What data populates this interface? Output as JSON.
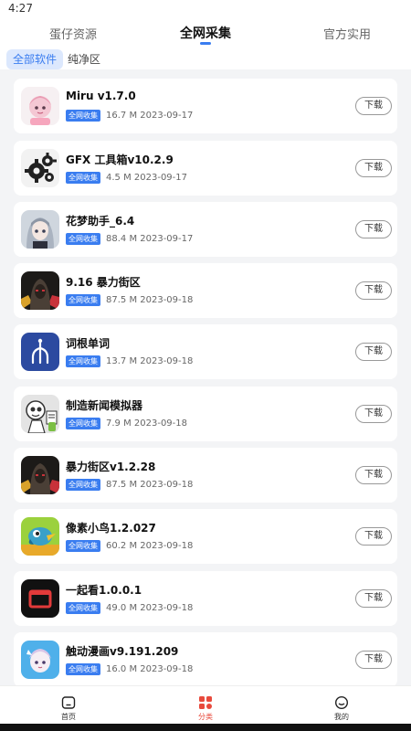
{
  "status_bar": {
    "time": "4:27"
  },
  "top_tabs": [
    "蛋仔资源",
    "全网采集",
    "官方实用"
  ],
  "sub_tabs": [
    "全部软件",
    "纯净区"
  ],
  "download_label": "下载",
  "badge_label": "全网收集",
  "apps": [
    {
      "name": "Miru v1.7.0",
      "meta": "16.7 M 2023-09-17",
      "icon": "miru-anime-girl-icon"
    },
    {
      "name": "GFX 工具箱v10.2.9",
      "meta": "4.5 M 2023-09-17",
      "icon": "gfx-gears-icon"
    },
    {
      "name": "花梦助手_6.4",
      "meta": "88.4 M 2023-09-17",
      "icon": "anime-character-icon"
    },
    {
      "name": "9.16 暴力街区",
      "meta": "87.5 M 2023-09-18",
      "icon": "hooded-figure-icon"
    },
    {
      "name": "词根单词",
      "meta": "13.7 M 2023-09-18",
      "icon": "word-root-tree-icon"
    },
    {
      "name": "制造新闻模拟器",
      "meta": "7.9 M 2023-09-18",
      "icon": "news-simulator-icon"
    },
    {
      "name": "暴力街区v1.2.28",
      "meta": "87.5 M 2023-09-18",
      "icon": "hooded-figure-icon"
    },
    {
      "name": "像素小鸟1.2.027",
      "meta": "60.2 M 2023-09-18",
      "icon": "pixel-bird-icon"
    },
    {
      "name": "一起看1.0.0.1",
      "meta": "49.0 M 2023-09-18",
      "icon": "watch-together-icon"
    },
    {
      "name": "触动漫画v9.191.209",
      "meta": "16.0 M 2023-09-18",
      "icon": "comic-girl-icon"
    }
  ],
  "bottom_nav": [
    {
      "label": "首页",
      "icon": "home-icon"
    },
    {
      "label": "分类",
      "icon": "category-icon"
    },
    {
      "label": "我的",
      "icon": "profile-icon"
    }
  ],
  "colors": {
    "accent": "#3a7df0",
    "nav_active": "#e84a3c"
  }
}
